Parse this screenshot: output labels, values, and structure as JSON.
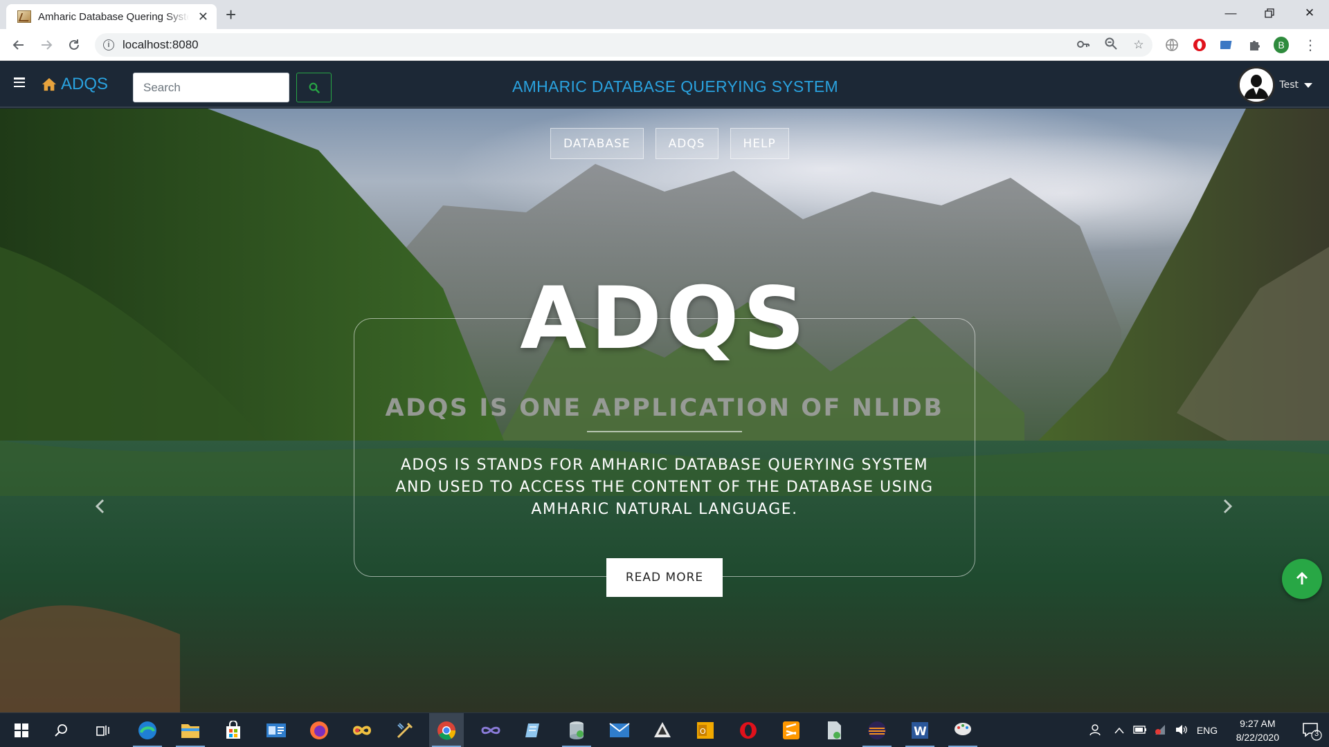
{
  "browser": {
    "tab_title": "Amharic Database Quering System",
    "url": "localhost:8080",
    "profile_initial": "B"
  },
  "navbar": {
    "brand": "ADQS",
    "search_placeholder": "Search",
    "title": "AMHARIC DATABASE QUERYING SYSTEM",
    "user_name": "Test"
  },
  "hero": {
    "menu": [
      "DATABASE",
      "ADQS",
      "HELP"
    ],
    "title": "ADQS",
    "subtitle": "ADQS IS ONE APPLICATION OF NLIDB",
    "description": "ADQS IS STANDS FOR AMHARIC DATABASE QUERYING SYSTEM AND USED TO ACCESS THE CONTENT OF THE DATABASE USING AMHARIC NATURAL LANGUAGE.",
    "button": "READ MORE"
  },
  "taskbar": {
    "language": "ENG",
    "time": "9:27 AM",
    "date": "8/22/2020",
    "notifications": "3"
  },
  "colors": {
    "navbar_bg": "#1c2836",
    "brand_blue": "#2aa3e0",
    "accent_green": "#28a745",
    "taskbar_bg": "#1b2531"
  }
}
